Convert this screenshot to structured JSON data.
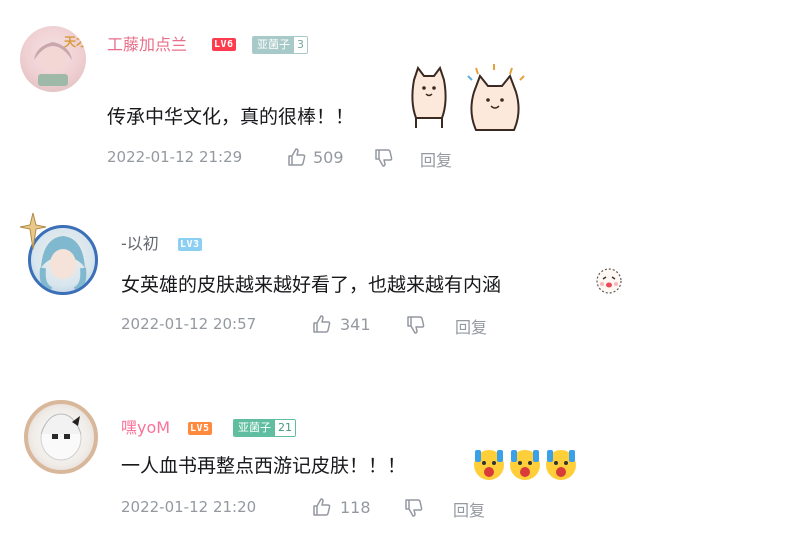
{
  "comments": [
    {
      "username": "工藤加点兰",
      "username_color": "#e86f8a",
      "level": "LV6",
      "level_color": "#ff3b4e",
      "fan_badge": {
        "name": "亚菌子",
        "level": "3",
        "color": "#a7c9c7"
      },
      "text": "传承中华文化，真的很棒！！",
      "time": "2022-01-12 21:29",
      "likes": "509",
      "reply_label": "回复",
      "sticker": "cat-stickers-pair"
    },
    {
      "username": "-以初",
      "username_color": "#61666d",
      "level": "LV3",
      "level_color": "#8bd0f2",
      "fan_badge": null,
      "text": "女英雄的皮肤越来越好看了，也越来越有内涵",
      "time": "2022-01-12 20:57",
      "likes": "341",
      "reply_label": "回复",
      "sticker": "cute-face-emoji"
    },
    {
      "username": "嘿yoM",
      "username_color": "#fb7299",
      "level": "LV5",
      "level_color": "#ff8a3d",
      "fan_badge": {
        "name": "亚菌子",
        "level": "21",
        "color": "#5fbe9f"
      },
      "text": "一人血书再整点西游记皮肤！！！",
      "time": "2022-01-12 21:20",
      "likes": "118",
      "reply_label": "回复",
      "sticker": "surprised-face-emoji-x3"
    }
  ]
}
